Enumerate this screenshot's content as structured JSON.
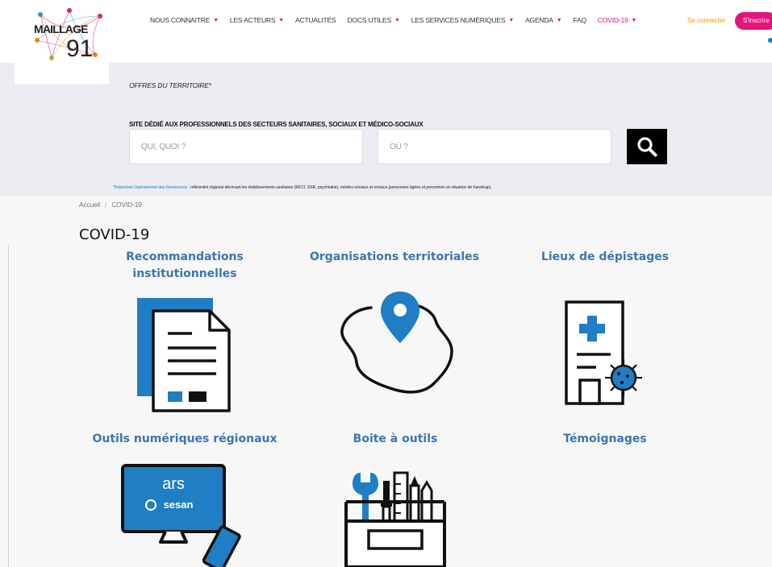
{
  "header": {
    "logo_text": "MAILLAGE",
    "logo_number": "91",
    "nav": [
      {
        "label": "NOUS CONNAITRE",
        "dropdown": true
      },
      {
        "label": "LES ACTEURS",
        "dropdown": true
      },
      {
        "label": "ACTUALITÉS",
        "dropdown": false
      },
      {
        "label": "DOCS UTILES",
        "dropdown": true
      },
      {
        "label": "LES SERVICES NUMÉRIQUES",
        "dropdown": true
      },
      {
        "label": "AGENDA",
        "dropdown": true
      },
      {
        "label": "FAQ",
        "dropdown": false
      },
      {
        "label": "COVID-19",
        "dropdown": true
      }
    ],
    "login_label": "Se connecter",
    "signup_label": "S'inscrire"
  },
  "search": {
    "offers_label": "OFFRES DU TERRITOIRE*",
    "site_dedicated": "SITE DÉDIÉ AUX PROFESSIONNELS DES SECTEURS SANITAIRES, SOCIAUX ET MÉDICO-SOCIAUX",
    "what_placeholder": "QUI, QUOI ?",
    "where_placeholder": "OÙ ?",
    "ror_link": "*Répertoire Opérationnel des Ressources :",
    "ror_text": " référentiel régional décrivant les établissements sanitaires (MCO, SSR, psychiatrie), médico-sociaux et sociaux (personnes âgées et personnes en situation de handicap)."
  },
  "breadcrumb": {
    "home": "Accueil",
    "separator": "/",
    "current": "COVID-19"
  },
  "page_title": "COVID-19",
  "tiles": [
    {
      "title": "Recommandations institutionnelles",
      "icon": "document-icon"
    },
    {
      "title": "Organisations territoriales",
      "icon": "map-pin-icon"
    },
    {
      "title": "Lieux de dépistages",
      "icon": "hospital-virus-icon"
    },
    {
      "title": "Outils numériques régionaux",
      "icon": "computer-phone-icon"
    },
    {
      "title": "Boite à outils",
      "icon": "toolbox-icon"
    },
    {
      "title": "Témoignages",
      "icon": ""
    }
  ],
  "monitor": {
    "line1": "ars",
    "line2": "sesan"
  },
  "colors": {
    "accent_pink": "#e6157d",
    "accent_orange": "#f29100",
    "title_blue": "#3b76b0",
    "icon_blue": "#1f7ec4"
  }
}
